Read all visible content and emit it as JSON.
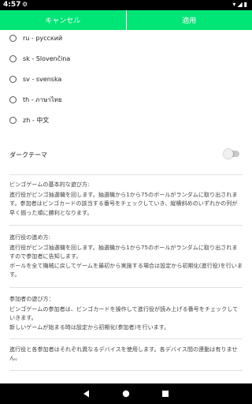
{
  "status": {
    "time": "4:57"
  },
  "actions": {
    "cancel": "キャンセル",
    "apply": "適用"
  },
  "languages": [
    "ru - русский",
    "sk - Slovenčina",
    "sv - svenska",
    "th - ภาษาไทย",
    "zh - 中文"
  ],
  "dark_theme": {
    "label": "ダークテーマ",
    "enabled": false
  },
  "sections": [
    {
      "title": "ビンゴゲームの基本的な遊び方:",
      "body": "進行役がビンゴ抽選機を回します。抽選機から1から75のボールがランダムに取り出されます。参加者はビンゴカードの該当する番号をチェックしていき、縦横斜めのいずれかの列が早く揃った順に勝利となります。"
    },
    {
      "title": "進行役の進め方:",
      "body": "進行役がビンゴ抽選機を回します。抽選機から1から75のボールがランダムに取り出されますので参加者に告知します。\nボールを全て機械に戻してゲームを最初から実施する場合は設定から初期化(進行役)を行います。"
    },
    {
      "title": "参加者の遊び方：",
      "body": "ビンゴゲームの参加者は、ビンゴカードを操作して進行役が読み上げる番号をチェックしていきます。\n新しいゲームが始まる時は設定から初期化(参加者)を行います。"
    },
    {
      "title": "",
      "body": "進行役と各参加者はそれぞれ異なるデバイスを使用します。各デバイス間の連動は有りません。"
    }
  ],
  "colors": {
    "accent": "#00e676",
    "status_bar": "#000000",
    "nav_bar": "#000000"
  },
  "icons": {
    "status_left": [
      "settings-icon"
    ],
    "status_right": [
      "wifi-icon",
      "signal-icon",
      "battery-icon"
    ],
    "nav": [
      "back-icon",
      "home-icon",
      "recents-icon"
    ]
  }
}
